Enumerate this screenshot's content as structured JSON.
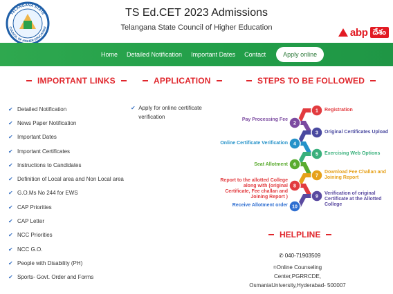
{
  "header": {
    "title": "TS Ed.CET 2023 Admissions",
    "subtitle": "Telangana State Council of Higher Education",
    "logo_top_text": "TELANGANA STATE",
    "logo_bottom_text": "COUNCIL OF HIGHER EDUCATION",
    "brand": {
      "name": "abp",
      "script": "దేశం",
      "color": "#e21b23"
    }
  },
  "nav": {
    "items": [
      "Home",
      "Detailed Notification",
      "Important Dates",
      "Contact"
    ],
    "apply_label": "Apply online",
    "color": "#2aa14c"
  },
  "important_links": {
    "heading": "IMPORTANT LINKS",
    "items": [
      "Detailed Notification",
      "News Paper Notification",
      "Important Dates",
      "Important Certificates",
      "Instructions to Candidates",
      "Definition of Local area and Non Local area",
      "G.O.Ms No 244 for EWS",
      "CAP Priorities",
      "CAP Letter",
      "NCC Priorities",
      "NCC G.O.",
      "People with Disability (PH)",
      "Sports- Govt. Order and Forms"
    ]
  },
  "application": {
    "heading": "APPLICATION",
    "item": "Apply for online certificate verification"
  },
  "steps": {
    "heading": "STEPS TO BE FOLLOWED",
    "items": [
      {
        "num": "1",
        "label": "Registration",
        "color": "#e23b3f"
      },
      {
        "num": "2",
        "label": "Pay Processing Fee",
        "color": "#7b4aa0"
      },
      {
        "num": "3",
        "label": "Original Certificates Upload",
        "color": "#4a4aa0"
      },
      {
        "num": "4",
        "label": "Online Certificate Verification",
        "color": "#2592c9"
      },
      {
        "num": "5",
        "label": "Exercising Web Options",
        "color": "#39b07c"
      },
      {
        "num": "6",
        "label": "Seat Allotment",
        "color": "#5aab2f"
      },
      {
        "num": "7",
        "label": "Download Fee Challan and Joining Report",
        "color": "#e6a11a"
      },
      {
        "num": "8",
        "label": "Report to the allotted College along with (original Certificate, Fee challan and Joining Report )",
        "color": "#e23b3f"
      },
      {
        "num": "9",
        "label": "Verification of original Certificate at the Allotted College",
        "color": "#5a4aa0"
      },
      {
        "num": "10",
        "label": "Receive Allotment order",
        "color": "#2f6fd1"
      }
    ]
  },
  "helpline": {
    "heading": "HELPLINE",
    "phone": "040-71903509",
    "address_line1": "Online Counseling Center,PGRRCDE,",
    "address_line2": "OsmaniaUniversity,Hyderabad- 500007"
  }
}
